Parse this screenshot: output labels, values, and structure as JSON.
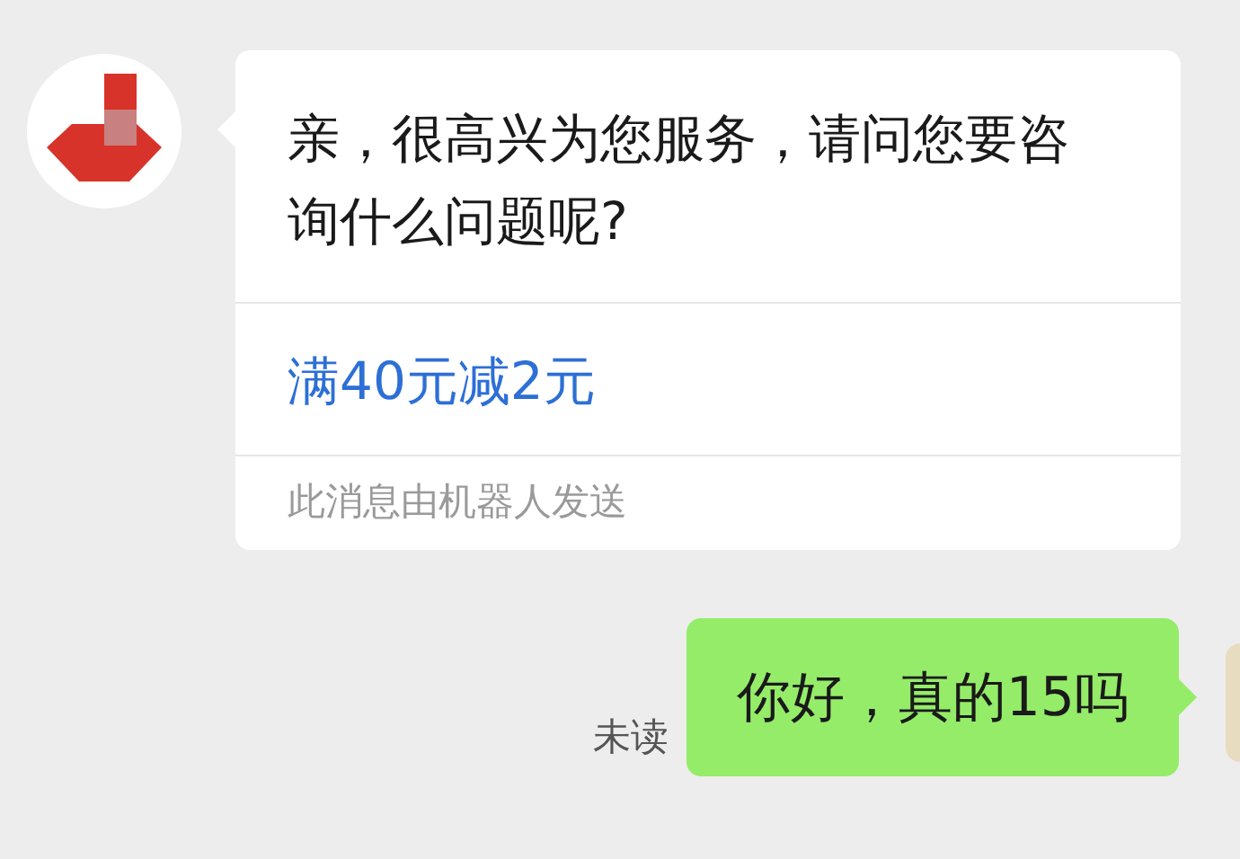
{
  "messages": [
    {
      "kind": "received",
      "text": "亲，很高兴为您服务，请问您要咨询什么问题呢?",
      "link": "满40元减2元",
      "footer": "此消息由机器人发送"
    },
    {
      "kind": "sent",
      "text": "你好，真的15吗",
      "status": "未读"
    }
  ]
}
